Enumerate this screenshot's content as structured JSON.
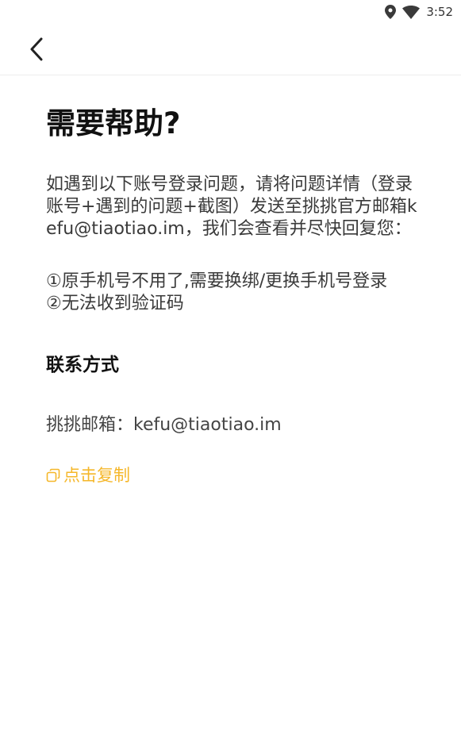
{
  "status_bar": {
    "time": "3:52",
    "icons": [
      "location-icon",
      "wifi-icon"
    ]
  },
  "header": {
    "back_icon": "back-chevron-icon"
  },
  "main": {
    "title": "需要帮助?",
    "intro": "如遇到以下账号登录问题，请将问题详情（登录账号+遇到的问题+截图）发送至挑挑官方邮箱kefu@tiaotiao.im，我们会查看并尽快回复您：",
    "issues": [
      "①原手机号不用了,需要换绑/更换手机号登录",
      "②无法收到验证码"
    ],
    "contact_title": "联系方式",
    "email_line": "挑挑邮箱：kefu@tiaotiao.im",
    "copy_label": "点击复制",
    "copy_icon": "copy-icon"
  },
  "colors": {
    "accent": "#f5b72a",
    "text": "#3a3a3a",
    "title": "#111111"
  }
}
